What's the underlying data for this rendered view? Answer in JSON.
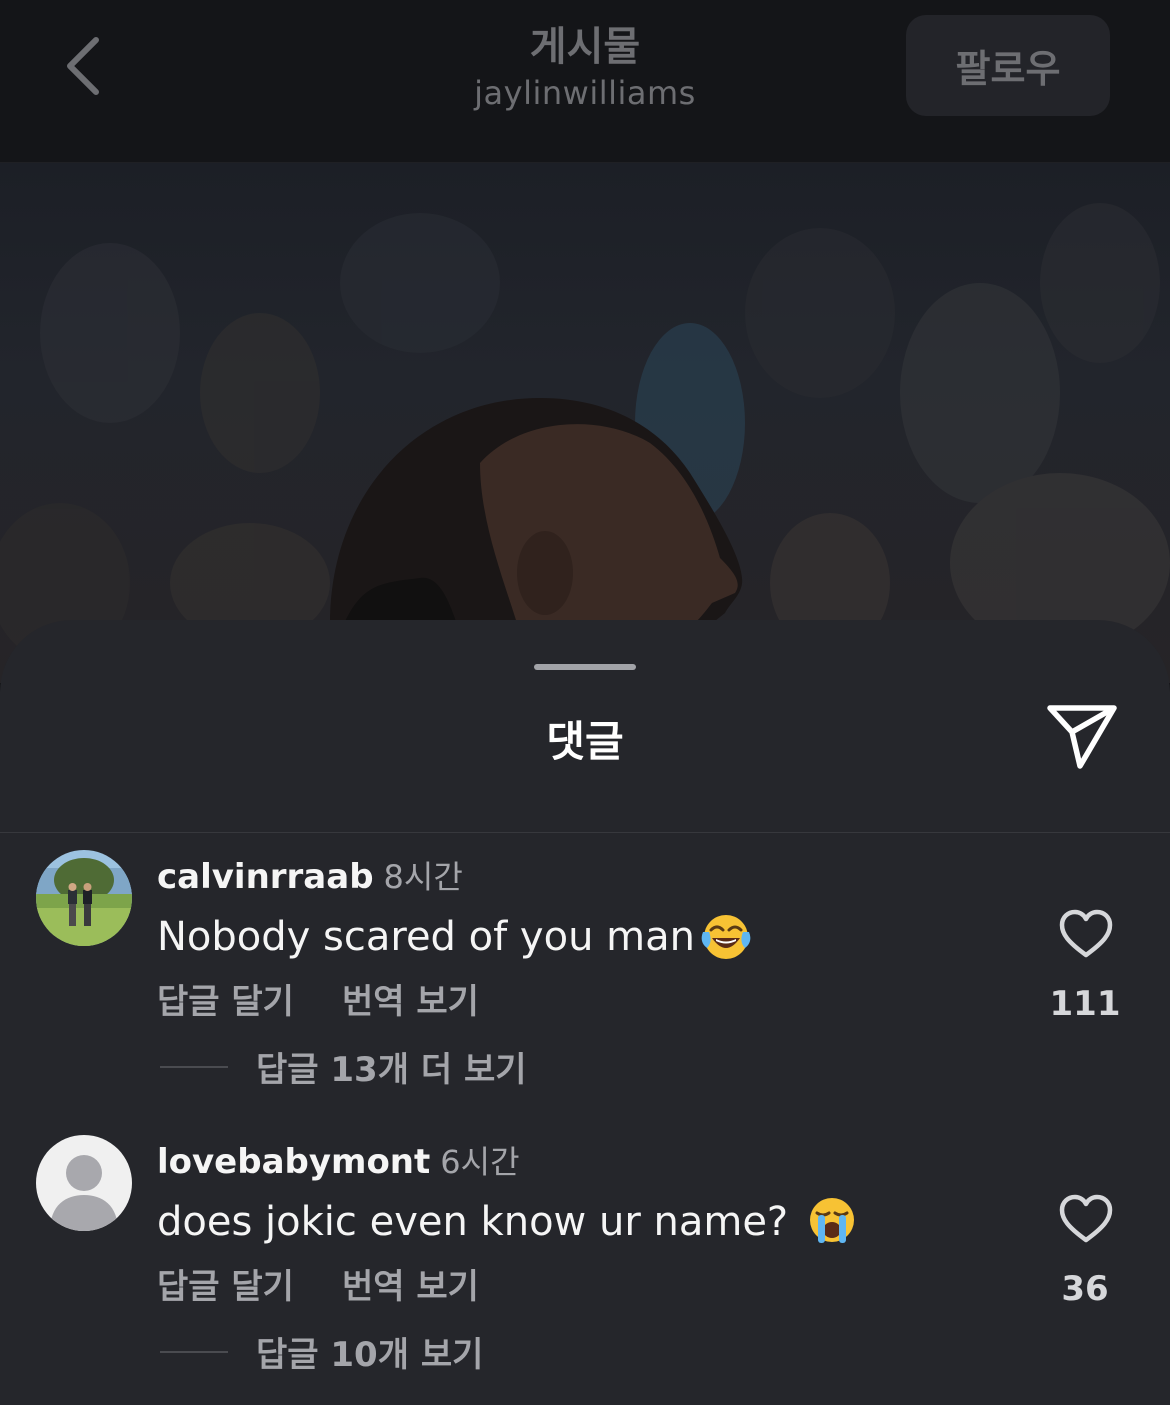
{
  "header": {
    "title": "게시물",
    "subtitle": "jaylinwilliams",
    "follow_label": "팔로우",
    "back_icon": "chevron-left-icon"
  },
  "sheet": {
    "title": "댓글",
    "share_icon": "send-icon"
  },
  "comments": [
    {
      "username": "calvinrraab",
      "time": "8시간",
      "text": "Nobody scared of you man",
      "emoji": "face-with-tears-of-joy",
      "reply_label": "답글 달기",
      "translate_label": "번역 보기",
      "view_replies": "답글 13개 더 보기",
      "like_count": "111",
      "avatar": "photo-avatar"
    },
    {
      "username": "lovebabymont",
      "time": "6시간",
      "text": "does jokic even know ur name? ",
      "emoji": "loudly-crying-face",
      "reply_label": "답글 달기",
      "translate_label": "번역 보기",
      "view_replies": "답글 10개 보기",
      "like_count": "36",
      "avatar": "default-avatar"
    }
  ],
  "colors": {
    "background": "#0b0c0e",
    "sheet": "#25262b",
    "primary_text": "#f5f5f5",
    "secondary_text": "#a4a5aa"
  }
}
